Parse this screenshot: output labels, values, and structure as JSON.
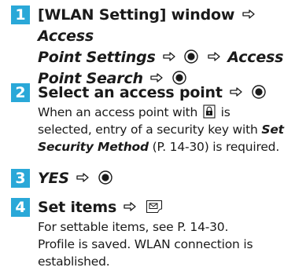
{
  "steps": [
    {
      "number": "1",
      "line1_a": "[WLAN Setting] window",
      "line1_b": "Access",
      "line2_a": "Point Settings",
      "line2_b": "Access",
      "line3_a": "Point Search"
    },
    {
      "number": "2",
      "head": "Select an access point",
      "desc1": "When an access point with",
      "desc1_b": "is",
      "desc2": "selected, entry of a security key with",
      "desc2_em": "Set",
      "desc3_em": "Security Method",
      "desc3": "(P. 14-30) is required."
    },
    {
      "number": "3",
      "head": "YES"
    },
    {
      "number": "4",
      "head": "Set items",
      "desc1": "For settable items, see P. 14-30.",
      "desc2": "Profile is saved. WLAN connection is",
      "desc3": "established."
    }
  ],
  "icons": {
    "arrow": "right-arrow-icon",
    "center_key": "center-key-icon",
    "mail_key": "mail-key-icon",
    "lock": "lock-icon"
  },
  "colors": {
    "badge": "#2aa8d8",
    "text": "#1a1a1a"
  }
}
